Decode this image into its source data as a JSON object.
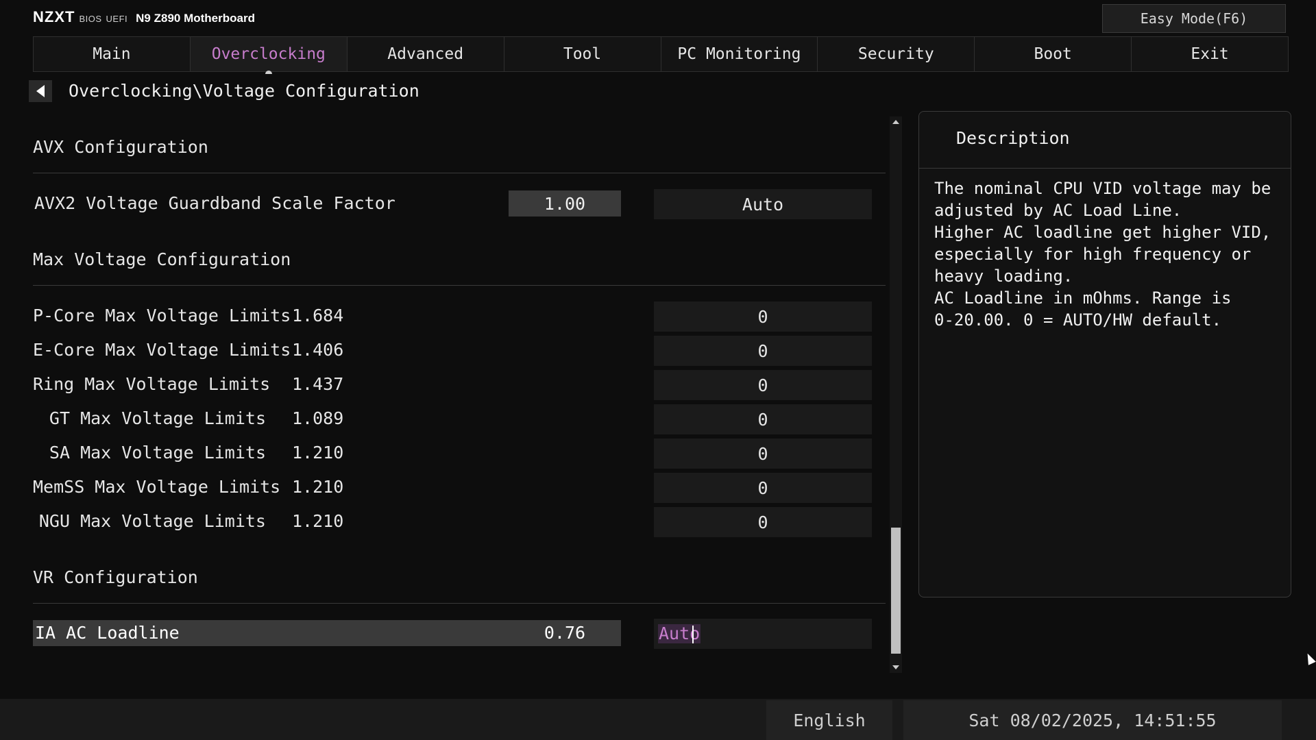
{
  "header": {
    "logo": "NZXT",
    "bios_label": "BIOS",
    "uefi_label": "UEFI",
    "model": "N9 Z890 Motherboard",
    "easy_mode": "Easy Mode(F6)"
  },
  "tabs": [
    {
      "label": "Main"
    },
    {
      "label": "Overclocking",
      "active": true
    },
    {
      "label": "Advanced"
    },
    {
      "label": "Tool"
    },
    {
      "label": "PC Monitoring"
    },
    {
      "label": "Security"
    },
    {
      "label": "Boot"
    },
    {
      "label": "Exit"
    }
  ],
  "breadcrumb": "Overclocking\\Voltage Configuration",
  "sections": {
    "avx": {
      "title": "AVX Configuration",
      "row": {
        "label": "AVX2 Voltage Guardband Scale Factor",
        "current": "1.00",
        "setting": "Auto"
      }
    },
    "max_voltage": {
      "title": "Max Voltage Configuration",
      "rows": [
        {
          "label": "P-Core Max Voltage Limits",
          "current": "1.684",
          "setting": "0"
        },
        {
          "label": "E-Core Max Voltage Limits",
          "current": "1.406",
          "setting": "0"
        },
        {
          "label": "Ring Max Voltage Limits",
          "current": "1.437",
          "setting": "0"
        },
        {
          "label": "GT Max Voltage Limits",
          "current": "1.089",
          "setting": "0"
        },
        {
          "label": "SA Max Voltage Limits",
          "current": "1.210",
          "setting": "0"
        },
        {
          "label": "MemSS Max Voltage Limits",
          "current": "1.210",
          "setting": "0"
        },
        {
          "label": "NGU Max Voltage Limits",
          "current": "1.210",
          "setting": "0"
        }
      ]
    },
    "vr": {
      "title": "VR Configuration",
      "row": {
        "label": "IA AC Loadline",
        "current": "0.76",
        "setting": "Auto"
      }
    }
  },
  "description": {
    "title": "Description",
    "lines": [
      "The nominal CPU VID voltage may be",
      "adjusted by AC Load Line.",
      "Higher AC loadline get higher VID,",
      "especially for high frequency or",
      "heavy loading.",
      "AC Loadline in mOhms. Range is",
      "0-20.00. 0 = AUTO/HW default."
    ]
  },
  "footer": {
    "language": "English",
    "datetime": "Sat 08/02/2025, 14:51:55"
  },
  "colors": {
    "accent": "#c77dcc",
    "background": "#0d0d0d",
    "field": "#1b1b1b",
    "selected": "#3a3a3a"
  }
}
